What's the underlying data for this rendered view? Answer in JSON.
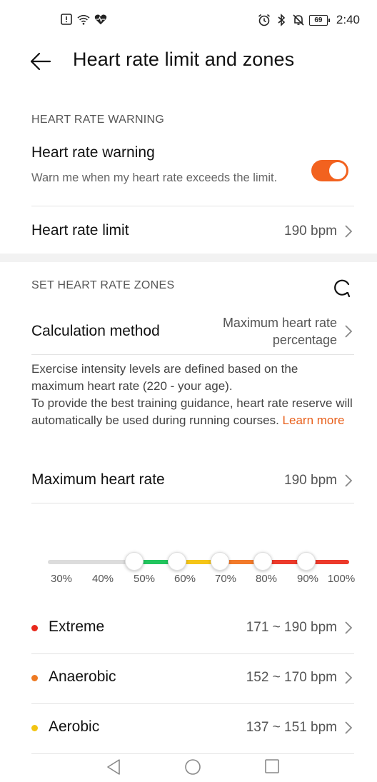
{
  "status_bar": {
    "time": "2:40",
    "battery": "69"
  },
  "header": {
    "title": "Heart rate limit and zones"
  },
  "warning_section": {
    "header": "HEART RATE WARNING",
    "warning_title": "Heart rate warning",
    "warning_desc": "Warn me when my heart rate exceeds the limit.",
    "warning_enabled": true,
    "limit_label": "Heart rate limit",
    "limit_value": "190 bpm"
  },
  "zones_section": {
    "header": "SET HEART RATE ZONES",
    "method_label": "Calculation method",
    "method_value_line1": "Maximum heart rate",
    "method_value_line2": "percentage",
    "description_1": "Exercise intensity levels are defined based on the maximum heart rate (220 - your age).",
    "description_2": "To provide the best training guidance, heart rate reserve will automatically be used during running courses. ",
    "learn_more": "Learn more",
    "max_hr_label": "Maximum heart rate",
    "max_hr_value": "190 bpm"
  },
  "slider": {
    "ticks": [
      "30%",
      "40%",
      "50%",
      "60%",
      "70%",
      "80%",
      "90%",
      "100%"
    ],
    "knob_percents": [
      50,
      60,
      70,
      80,
      90
    ],
    "colors": {
      "inactive": "#dcdcdc",
      "light": "#22c55e",
      "aerobic": "#f5c518",
      "anaerobic": "#f27a2a",
      "extreme": "#ec3a2b"
    }
  },
  "zones": [
    {
      "name": "Extreme",
      "range": "171 ~ 190 bpm",
      "color": "#e8291c"
    },
    {
      "name": "Anaerobic",
      "range": "152 ~ 170 bpm",
      "color": "#ee7a22"
    },
    {
      "name": "Aerobic",
      "range": "137 ~ 151 bpm",
      "color": "#f2c412"
    }
  ]
}
